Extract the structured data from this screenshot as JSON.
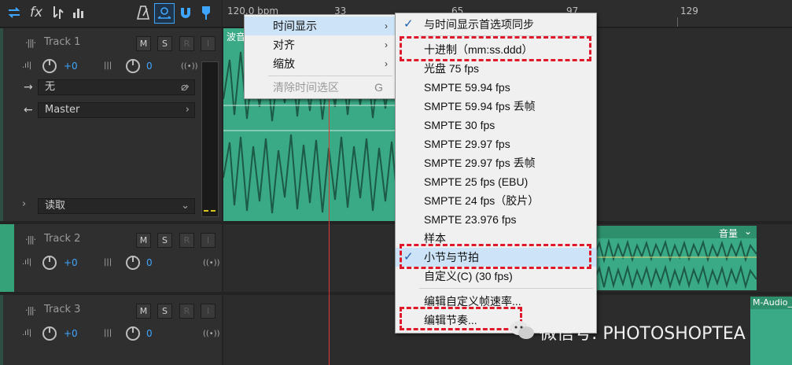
{
  "ruler": {
    "labels": [
      "120.0 bpm",
      "33",
      "65",
      "97",
      "129"
    ]
  },
  "tracks": [
    {
      "name": "Track 1",
      "msri": [
        "M",
        "S",
        "R",
        "I"
      ],
      "volume": "+0",
      "pan": "0",
      "input": "无",
      "output": "Master",
      "automation": "读取"
    },
    {
      "name": "Track 2",
      "msri": [
        "M",
        "S",
        "R",
        "I"
      ],
      "volume": "+0",
      "pan": "0"
    },
    {
      "name": "Track 3",
      "msri": [
        "M",
        "S",
        "R",
        "I"
      ],
      "volume": "+0",
      "pan": "0"
    }
  ],
  "clips": {
    "track1_label": "波音",
    "track2_label": "音量",
    "track3_label": "M-Audio_"
  },
  "main_menu": {
    "items": [
      {
        "label": "时间显示",
        "shortcut": ""
      },
      {
        "label": "对齐",
        "shortcut": ""
      },
      {
        "label": "缩放",
        "shortcut": ""
      },
      {
        "label": "清除时间选区",
        "shortcut": "G"
      }
    ]
  },
  "submenu": {
    "items": [
      {
        "label": "与时间显示首选项同步",
        "checked": true
      },
      {
        "label": "十进制（mm:ss.ddd）"
      },
      {
        "label": "光盘 75 fps"
      },
      {
        "label": "SMPTE 59.94 fps"
      },
      {
        "label": "SMPTE 59.94 fps 丢帧"
      },
      {
        "label": "SMPTE 30 fps"
      },
      {
        "label": "SMPTE 29.97 fps"
      },
      {
        "label": "SMPTE 29.97 fps 丢帧"
      },
      {
        "label": "SMPTE 25 fps (EBU)"
      },
      {
        "label": "SMPTE 24 fps（胶片）"
      },
      {
        "label": "SMPTE 23.976 fps"
      },
      {
        "label": "样本"
      },
      {
        "label": "小节与节拍",
        "checked": true
      },
      {
        "label": "自定义(C) (30 fps)"
      },
      {
        "label": "编辑自定义帧速率..."
      },
      {
        "label": "编辑节奏..."
      }
    ]
  },
  "watermark": {
    "text": "微信号: PHOTOSHOPTEA"
  },
  "colors": {
    "accent": "#36a27a",
    "waveform": "#3aa985",
    "playhead": "#d83a3a",
    "highlight": "#cde3f7",
    "annotation": "#e0192a"
  }
}
